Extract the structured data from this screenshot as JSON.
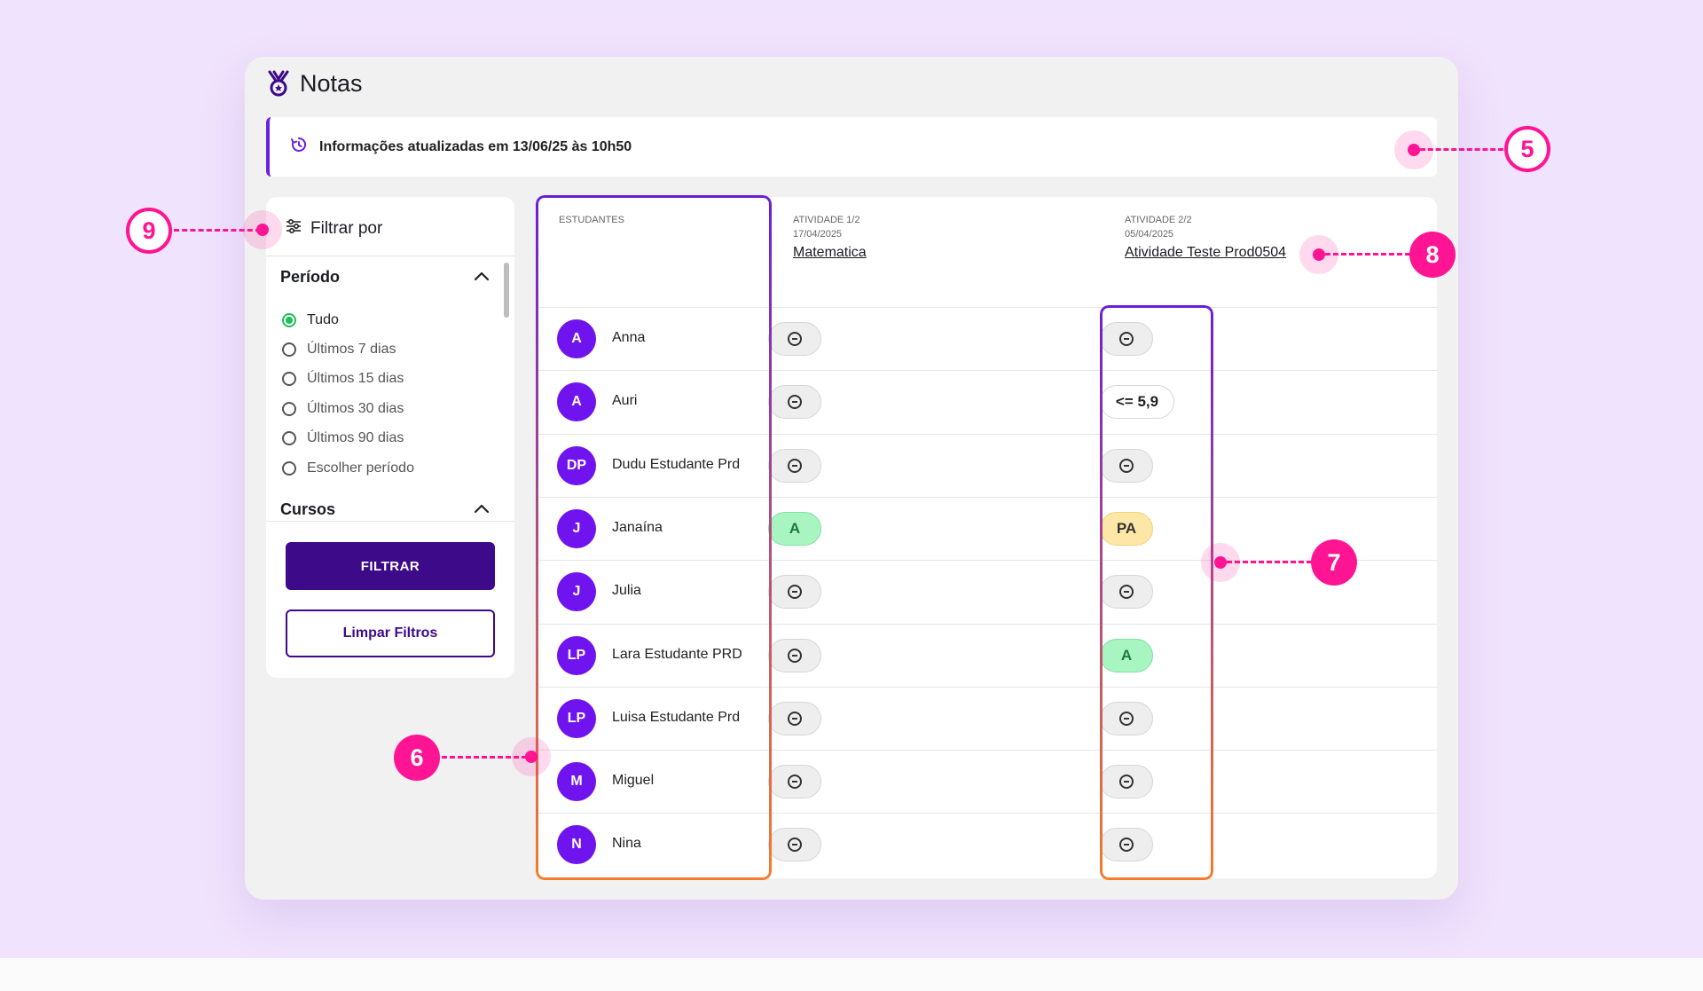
{
  "header": {
    "title": "Notas",
    "icon": "medal-icon"
  },
  "info_bar": {
    "text": "Informações atualizadas em 13/06/25 às 10h50",
    "icon": "refresh-clock-icon"
  },
  "filter": {
    "title": "Filtrar por",
    "icon": "sliders-icon",
    "periodo": {
      "title": "Período",
      "options": [
        {
          "label": "Tudo",
          "selected": true
        },
        {
          "label": "Últimos 7 dias",
          "selected": false
        },
        {
          "label": "Últimos 15 dias",
          "selected": false
        },
        {
          "label": "Últimos 30 dias",
          "selected": false
        },
        {
          "label": "Últimos 90 dias",
          "selected": false
        },
        {
          "label": "Escolher período",
          "selected": false
        }
      ]
    },
    "cursos": {
      "title": "Cursos"
    },
    "filtrar_label": "FILTRAR",
    "limpar_label": "Limpar Filtros"
  },
  "table": {
    "students_header": "ESTUDANTES",
    "activities": [
      {
        "label": "ATIVIDADE 1/2",
        "date": "17/04/2025",
        "name": "Matematica"
      },
      {
        "label": "ATIVIDADE 2/2",
        "date": "05/04/2025",
        "name": "Atividade Teste Prod0504"
      }
    ],
    "rows": [
      {
        "initials": "A",
        "name": "Anna",
        "grades": [
          "empty",
          "empty"
        ]
      },
      {
        "initials": "A",
        "name": "Auri",
        "grades": [
          "empty",
          "<= 5,9"
        ]
      },
      {
        "initials": "DP",
        "name": "Dudu Estudante Prd",
        "grades": [
          "empty",
          "empty"
        ]
      },
      {
        "initials": "J",
        "name": "Janaína",
        "grades": [
          "A",
          "PA"
        ]
      },
      {
        "initials": "J",
        "name": "Julia",
        "grades": [
          "empty",
          "empty"
        ]
      },
      {
        "initials": "LP",
        "name": "Lara Estudante PRD",
        "grades": [
          "empty",
          "A"
        ]
      },
      {
        "initials": "LP",
        "name": "Luisa Estudante Prd",
        "grades": [
          "empty",
          "empty"
        ]
      },
      {
        "initials": "M",
        "name": "Miguel",
        "grades": [
          "empty",
          "empty"
        ]
      },
      {
        "initials": "N",
        "name": "Nina",
        "grades": [
          "empty",
          "empty"
        ]
      }
    ]
  },
  "callouts": [
    "5",
    "6",
    "7",
    "8",
    "9"
  ],
  "colors": {
    "background": "#f0e3fd",
    "accent": "#6b1fe0",
    "avatar": "#7014ef",
    "primary_button": "#3d0a8a",
    "callout": "#ff1493",
    "grade_a": "#a8f5c1",
    "grade_pa": "#fde7a6"
  }
}
